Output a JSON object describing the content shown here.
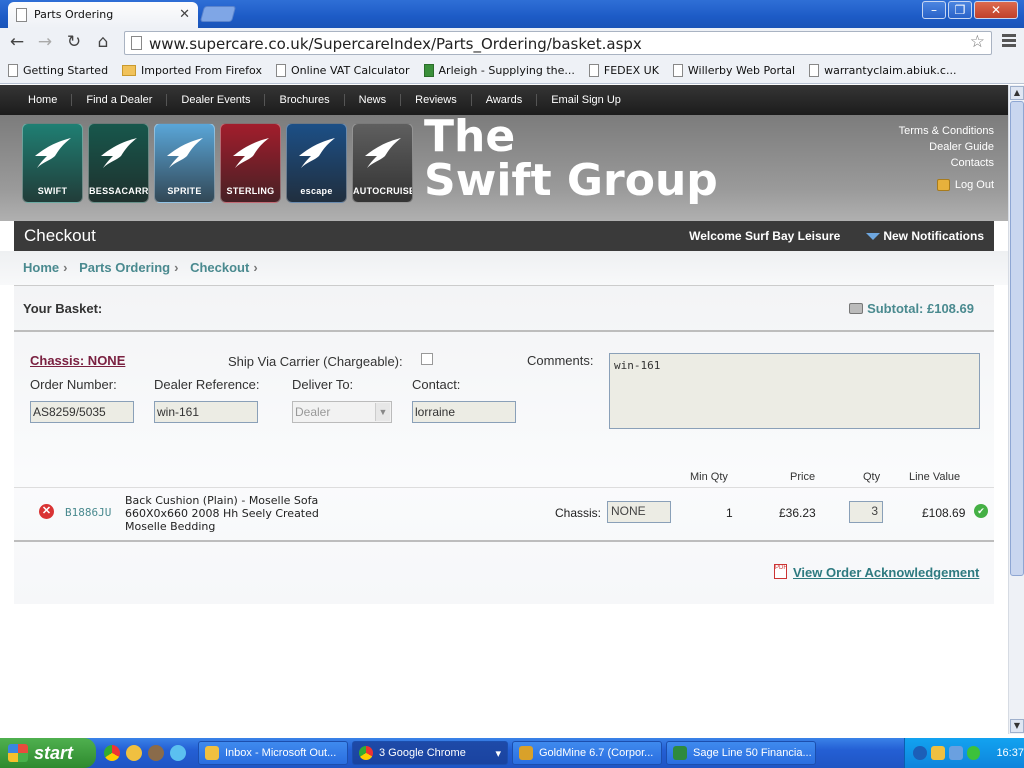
{
  "browser": {
    "tab_title": "Parts Ordering",
    "url": "www.supercare.co.uk/SupercareIndex/Parts_Ordering/basket.aspx",
    "bookmarks": [
      "Getting Started",
      "Imported From Firefox",
      "Online VAT Calculator",
      "Arleigh - Supplying the...",
      "FEDEX UK",
      "Willerby Web Portal",
      "warrantyclaim.abiuk.c..."
    ]
  },
  "site": {
    "topnav": [
      "Home",
      "Find a Dealer",
      "Dealer Events",
      "Brochures",
      "News",
      "Reviews",
      "Awards",
      "Email Sign Up"
    ],
    "brands": [
      {
        "name": "SWIFT",
        "color": "#1f7f73"
      },
      {
        "name": "BESSACARR",
        "color": "#17574c"
      },
      {
        "name": "SPRITE",
        "color": "#5aa6d8"
      },
      {
        "name": "STERLING",
        "color": "#a21d2c"
      },
      {
        "name": "escape",
        "color": "#1c4f86"
      },
      {
        "name": "AUTOCRUISE",
        "color": "#5f5f5f"
      }
    ],
    "title_line1": "The",
    "title_line2": "Swift Group",
    "toplinks": [
      "Terms & Conditions",
      "Dealer Guide",
      "Contacts"
    ],
    "logout": "Log Out"
  },
  "checkout": {
    "title": "Checkout",
    "welcome": "Welcome Surf Bay Leisure",
    "notifications": "New Notifications",
    "breadcrumbs": [
      "Home",
      "Parts Ordering",
      "Checkout"
    ]
  },
  "basket": {
    "heading": "Your Basket:",
    "subtotal": "Subtotal: £108.69"
  },
  "form": {
    "chassis": "Chassis: NONE",
    "ship_via": "Ship Via Carrier (Chargeable):",
    "comments_label": "Comments:",
    "order_number_label": "Order Number:",
    "order_number": "AS8259/5035",
    "dealer_ref_label": "Dealer Reference:",
    "dealer_ref": "win-161",
    "deliver_to_label": "Deliver To:",
    "deliver_to": "Dealer",
    "contact_label": "Contact:",
    "contact": "lorraine",
    "comments": "win-161"
  },
  "table": {
    "headers": {
      "min_qty": "Min Qty",
      "price": "Price",
      "qty": "Qty",
      "line_value": "Line Value"
    },
    "rows": [
      {
        "code": "B1886JU",
        "description": "Back Cushion (Plain) - Moselle Sofa 660X0x660 2008 Hh Seely Created Moselle Bedding",
        "chassis_label": "Chassis:",
        "chassis": "NONE",
        "min_qty": "1",
        "price": "£36.23",
        "qty": "3",
        "line_value": "£108.69"
      }
    ]
  },
  "acknowledgement": "View Order Acknowledgement",
  "taskbar": {
    "start": "start",
    "items": [
      "Inbox - Microsoft Out...",
      "3 Google Chrome",
      "GoldMine 6.7 (Corpor...",
      "Sage Line 50 Financia..."
    ],
    "clock": "16:37"
  }
}
